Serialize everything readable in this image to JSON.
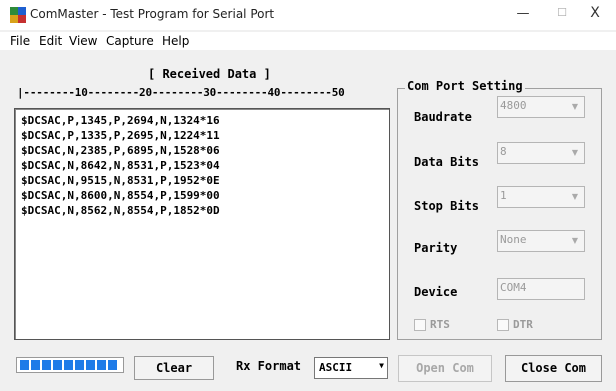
{
  "window": {
    "title": "ComMaster - Test Program for Serial Port",
    "min_glyph": "—",
    "max_glyph": "☐",
    "close_glyph": "X"
  },
  "menu": [
    "File",
    "Edit",
    "View",
    "Capture",
    "Help"
  ],
  "received": {
    "title": "[ Received Data ]",
    "ruler": "|--------10--------20--------30--------40--------50",
    "lines": [
      "$DCSAC,P,1345,P,2694,N,1324*16",
      "$DCSAC,P,1335,P,2695,N,1224*11",
      "$DCSAC,N,2385,P,6895,N,1528*06",
      "$DCSAC,N,8642,N,8531,P,1523*04",
      "$DCSAC,N,9515,N,8531,P,1952*0E",
      "$DCSAC,N,8600,N,8554,P,1599*00",
      "$DCSAC,N,8562,N,8554,P,1852*0D"
    ]
  },
  "settings": {
    "title": "Com Port Setting",
    "baudrate_label": "Baudrate",
    "baudrate_value": "4800",
    "databits_label": "Data Bits",
    "databits_value": "8",
    "stopbits_label": "Stop Bits",
    "stopbits_value": "1",
    "parity_label": "Parity",
    "parity_value": "None",
    "device_label": "Device",
    "device_value": "COM4",
    "rts_label": "RTS",
    "dtr_label": "DTR"
  },
  "bottom": {
    "progress_segments": 9,
    "clear_label": "Clear",
    "rx_format_label": "Rx Format",
    "rx_format_value": "ASCII",
    "open_label": "Open Com",
    "close_label": "Close Com"
  },
  "colors": {
    "progress": "#1e7be8"
  },
  "icons": {
    "app": "app-icon",
    "dropdown": "chevron-down-icon"
  }
}
